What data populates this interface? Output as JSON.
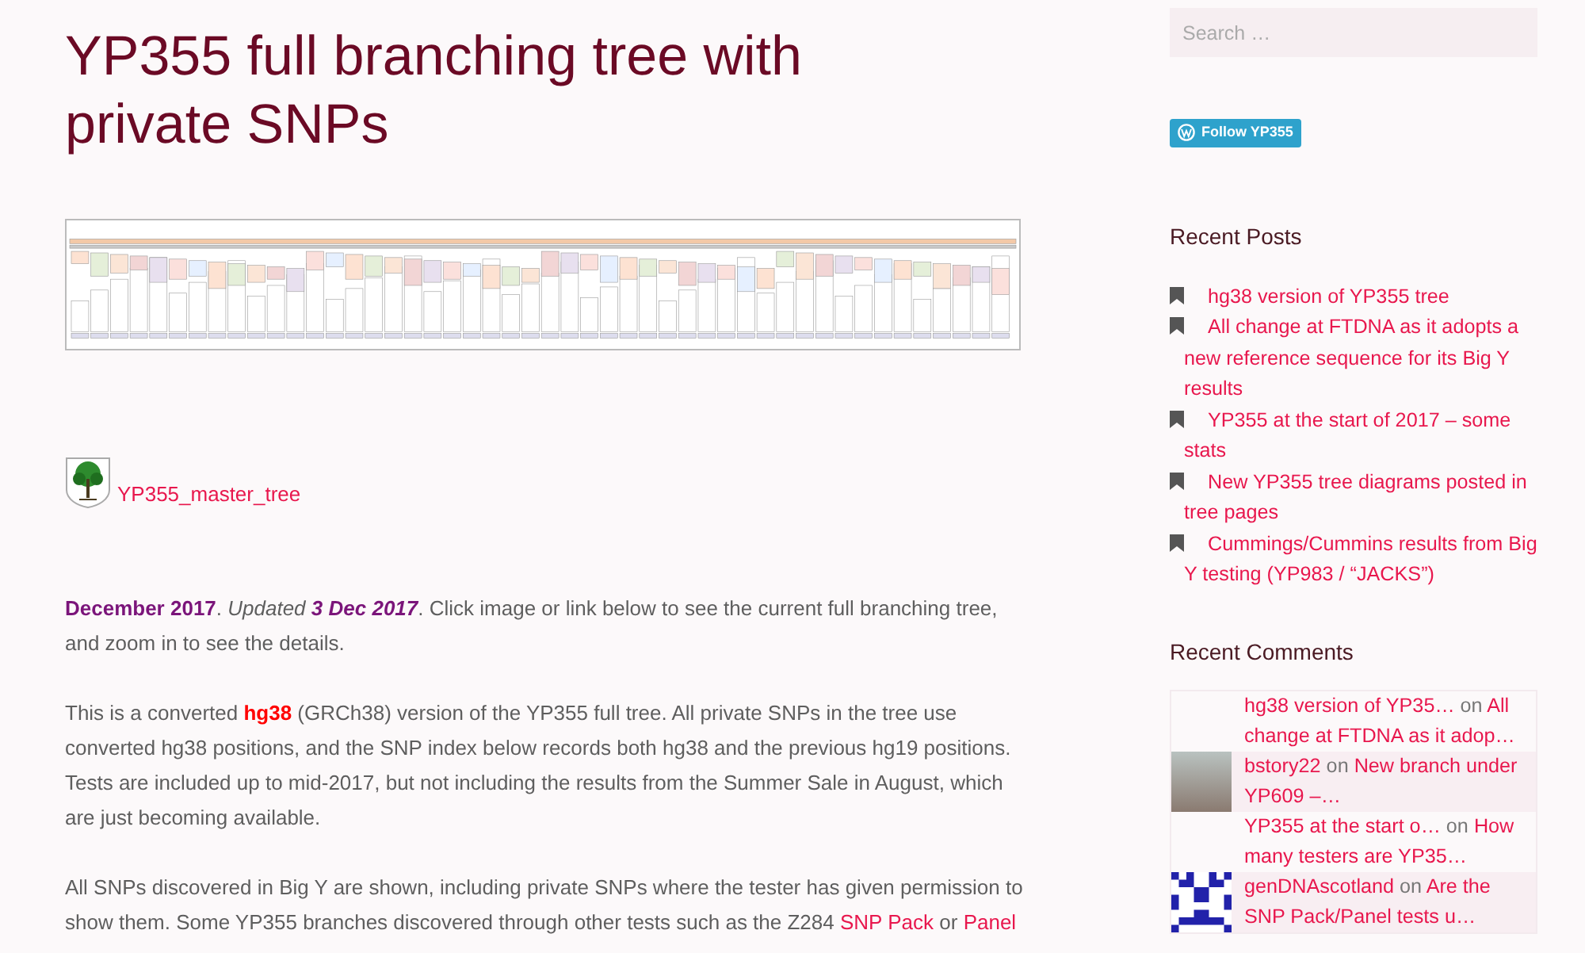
{
  "article": {
    "title": "YP355 full branching tree with private SNPs",
    "attachment": {
      "link": "YP355_master_tree"
    },
    "paragraphs": [
      {
        "segments": [
          {
            "kind": "emph",
            "text": "December 2017"
          },
          {
            "kind": "plain",
            "text": ".  "
          },
          {
            "kind": "italic",
            "text": "Updated "
          },
          {
            "kind": "emph_italic",
            "text": "3 Dec 2017"
          },
          {
            "kind": "plain",
            "text": ".  Click image or link below to see the current full branching tree, and zoom in to see the details."
          }
        ]
      },
      {
        "segments": [
          {
            "kind": "plain",
            "text": "This is a converted "
          },
          {
            "kind": "alert",
            "text": "hg38"
          },
          {
            "kind": "plain",
            "text": " (GRCh38) version of the YP355 full tree.  All private SNPs in the tree use converted hg38 positions, and the SNP index below records both hg38 and the previous hg19 positions.  Tests are included up to mid-2017, but not including the results from the Summer Sale in August, which are just becoming available."
          }
        ]
      },
      {
        "segments": [
          {
            "kind": "plain",
            "text": "All SNPs discovered in Big Y are shown, including private SNPs where the tester has given permission to show them.  Some YP355 branches discovered through other tests such as the Z284 "
          },
          {
            "kind": "link",
            "text": "SNP Pack"
          },
          {
            "kind": "plain",
            "text": " or "
          },
          {
            "kind": "link",
            "text": "Panel"
          }
        ]
      }
    ]
  },
  "sidebar": {
    "search": {
      "placeholder": "Search …"
    },
    "follow_button": "Follow YP355",
    "recent_posts": {
      "heading": "Recent Posts",
      "items": [
        "hg38 version of YP355 tree",
        "All change at FTDNA as it adopts a new reference sequence for its Big Y results",
        "YP355 at the start of 2017 – some stats",
        "New YP355 tree diagrams posted in tree pages",
        "Cummings/Cummins results from Big Y testing (YP983 / “JACKS”)"
      ]
    },
    "recent_comments": {
      "heading": "Recent Comments",
      "items": [
        {
          "kind": "blank",
          "author": "hg38 version of YP35…",
          "on": "on",
          "post": "All change at FTDNA as it adop…"
        },
        {
          "kind": "photo",
          "author": "bstory22",
          "on": "on",
          "post": "New branch under YP609 –…"
        },
        {
          "kind": "blank",
          "author": "YP355 at the start o…",
          "on": "on",
          "post": "How many testers are YP35…"
        },
        {
          "kind": "pattern",
          "author": "genDNAscotland",
          "on": "on",
          "post": "Are the SNP Pack/Panel tests u…"
        }
      ]
    }
  }
}
